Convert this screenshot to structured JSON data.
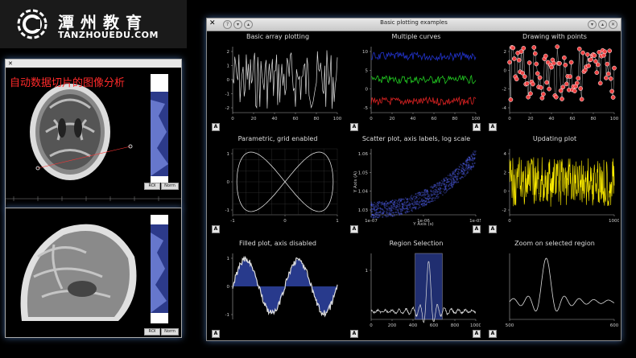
{
  "logo": {
    "cn": "潭州教育",
    "en": "TANZHOUEDU.COM"
  },
  "left_caption": "自动数据切片的图像分析",
  "left_window": {
    "roi_label": "ROI",
    "norm_label": "Norm"
  },
  "main_window": {
    "title": "Basic plotting examples",
    "plots": [
      {
        "title": "Basic array plotting",
        "xticks": [
          "0",
          "20",
          "40",
          "60",
          "80",
          "100"
        ],
        "yticks": [
          "2",
          "1",
          "0",
          "-1",
          "-2"
        ]
      },
      {
        "title": "Multiple curves",
        "xticks": [
          "0",
          "20",
          "40",
          "60",
          "80",
          "100"
        ],
        "yticks": [
          "10",
          "5",
          "0",
          "-5"
        ]
      },
      {
        "title": "Drawing with points",
        "xticks": [
          "0",
          "20",
          "40",
          "60",
          "80",
          "100"
        ],
        "yticks": [
          "2",
          "0",
          "-2",
          "-4"
        ]
      },
      {
        "title": "Parametric, grid enabled",
        "xticks": [
          "-1",
          "0",
          "1"
        ],
        "yticks": [
          "1",
          "0",
          "-1"
        ]
      },
      {
        "title": "Scatter plot, axis labels, log scale",
        "xticks": [
          "1e-07",
          "1e-06",
          "1e-05"
        ],
        "yticks": [
          "1.06",
          "1.05",
          "1.04",
          "1.03"
        ],
        "xlabel": "Y Axis (s)",
        "ylabel": "Y Axis (A)"
      },
      {
        "title": "Updating plot",
        "xticks": [
          "0",
          "1000"
        ],
        "yticks": [
          "4",
          "2",
          "0",
          "-2"
        ]
      },
      {
        "title": "Filled plot, axis disabled",
        "xticks": [],
        "yticks": [
          "1",
          "0",
          "-1"
        ]
      },
      {
        "title": "Region Selection",
        "xticks": [
          "0",
          "200",
          "400",
          "600",
          "800",
          "1000"
        ],
        "yticks": [
          "1"
        ]
      },
      {
        "title": "Zoom on selected region",
        "xticks": [
          "500",
          "600"
        ],
        "yticks": []
      }
    ],
    "auto_button": "A"
  },
  "colors": {
    "curve_white": "#dddddd",
    "blue": "#2233cc",
    "green": "#22cc22",
    "red": "#dd2222",
    "yellow": "#ffee00",
    "scatter": "#5566ff",
    "fill": "#283a8c"
  }
}
